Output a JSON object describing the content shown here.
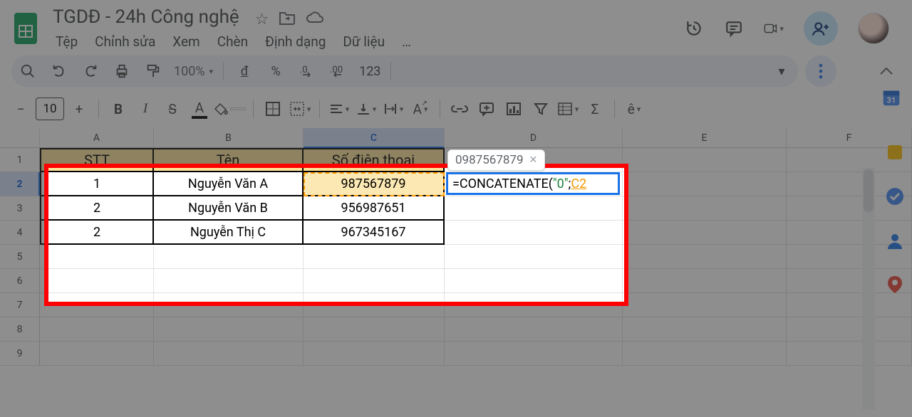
{
  "doc": {
    "title": "TGDĐ - 24h Công nghệ"
  },
  "menubar": [
    "Tệp",
    "Chỉnh sửa",
    "Xem",
    "Chèn",
    "Định dạng",
    "Dữ liệu",
    "…"
  ],
  "toolbar": {
    "zoom": "100%",
    "currency": "đ",
    "percent": "%",
    "dec_dec": ".0",
    "dec_inc": ".00",
    "number_format": "123"
  },
  "format": {
    "font_size": "10",
    "e_hat": "ê"
  },
  "columns": [
    "A",
    "B",
    "C",
    "D",
    "E",
    "F"
  ],
  "rows": [
    "1",
    "2",
    "3",
    "4",
    "5",
    "6",
    "7",
    "8",
    "9"
  ],
  "table": {
    "headers": {
      "stt": "STT",
      "ten": "Tên",
      "sdt": "Số điện thoại"
    },
    "data": [
      {
        "stt": "1",
        "ten": "Nguyễn Văn A",
        "sdt": "987567879"
      },
      {
        "stt": "2",
        "ten": "Nguyễn Văn B",
        "sdt": "956987651"
      },
      {
        "stt": "2",
        "ten": "Nguyễn Thị C",
        "sdt": "967345167"
      }
    ]
  },
  "active": {
    "tooltip": "0987567879",
    "formula_eq": "=",
    "formula_fn": "CONCATENATE",
    "formula_open": "(",
    "formula_str": "\"0\"",
    "formula_sep": ";",
    "formula_ref": "C2"
  }
}
